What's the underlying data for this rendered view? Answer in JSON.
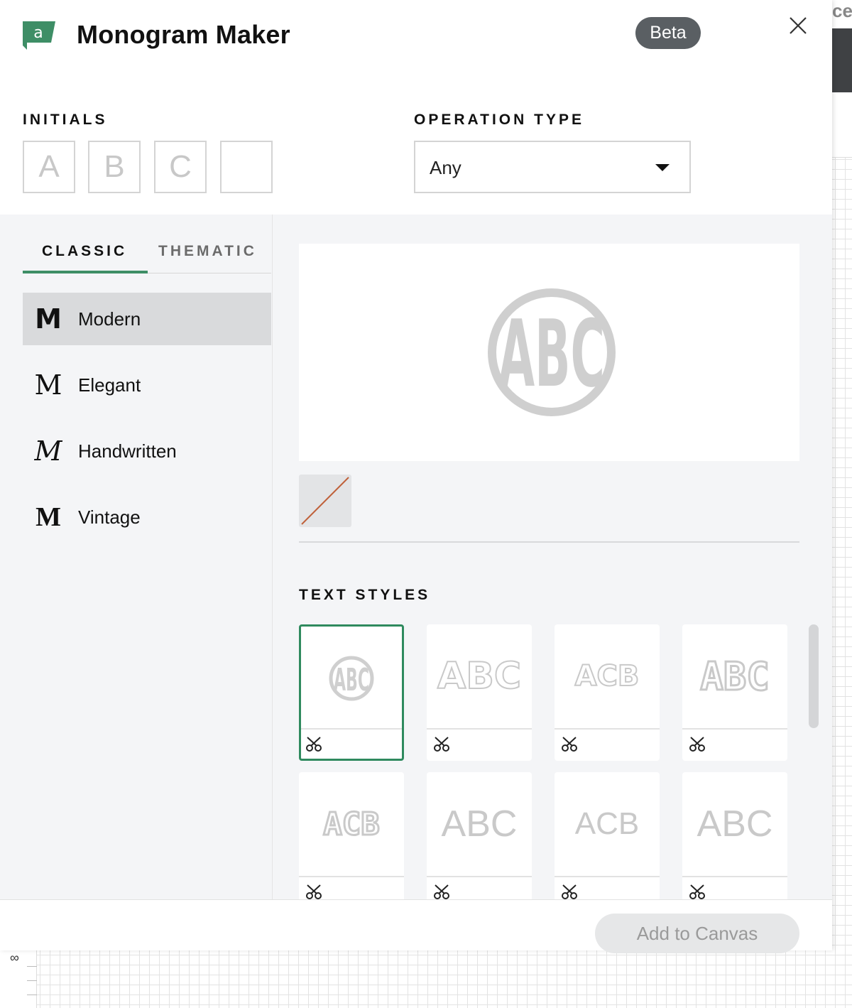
{
  "app": {
    "title": "Monogram Maker",
    "badge": "Beta"
  },
  "initials": {
    "label": "INITIALS",
    "boxes": [
      {
        "value": "A"
      },
      {
        "value": "B"
      },
      {
        "value": "C"
      },
      {
        "value": ""
      }
    ]
  },
  "operation": {
    "label": "OPERATION TYPE",
    "selected": "Any"
  },
  "tabs": [
    {
      "label": "CLASSIC",
      "active": true
    },
    {
      "label": "THEMATIC",
      "active": false
    }
  ],
  "categories": [
    {
      "icon_char": "M",
      "icon": "modern-m-icon",
      "label": "Modern",
      "active": true
    },
    {
      "icon_char": "M",
      "icon": "elegant-m-icon",
      "label": "Elegant",
      "active": false
    },
    {
      "icon_char": "M",
      "icon": "handwritten-m-icon",
      "label": "Handwritten",
      "active": false
    },
    {
      "icon_char": "M",
      "icon": "vintage-m-icon",
      "label": "Vintage",
      "active": false
    }
  ],
  "preview": {
    "monogram": "ABC"
  },
  "text_styles": {
    "label": "TEXT STYLES",
    "items": [
      {
        "style": "circle-monogram",
        "text": "ABC",
        "selected": true
      },
      {
        "style": "outline-serif",
        "text": "ABC",
        "selected": false
      },
      {
        "style": "big-middle-outline",
        "text": "ACB",
        "selected": false
      },
      {
        "style": "block-outline",
        "text": "ABC",
        "selected": false
      },
      {
        "style": "varsity-middle",
        "text": "ACB",
        "selected": false
      },
      {
        "style": "thin-sans",
        "text": "ABC",
        "selected": false
      },
      {
        "style": "thin-middle",
        "text": "ACB",
        "selected": false
      },
      {
        "style": "thin-sans-2",
        "text": "ABC",
        "selected": false
      }
    ]
  },
  "footer": {
    "add_label": "Add to Canvas"
  },
  "background": {
    "top_text": "ce",
    "ruler_label": "∞"
  },
  "colors": {
    "accent": "#2f8a5e",
    "badge": "#5a5f63",
    "placeholder": "#c9c9c9",
    "swatch_slash": "#c0623c"
  }
}
